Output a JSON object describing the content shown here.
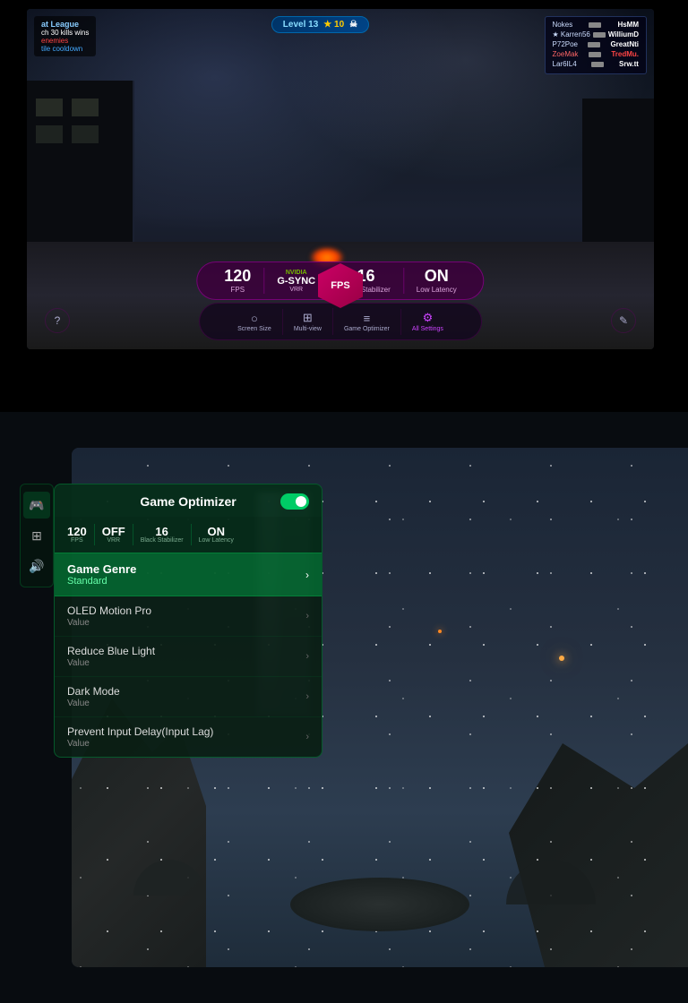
{
  "top": {
    "game_title": "at League",
    "kills_text": "ch 30 kills wins",
    "enemies_text": "enemies",
    "cooldown_text": "tile cooldown",
    "level_badge": "Level 13",
    "level_stars": "★ 10",
    "skull_icon": "☠",
    "players": [
      {
        "name": "Nokes",
        "weapon": "rifle",
        "score": "HsMM"
      },
      {
        "name": "Karren56",
        "weapon": "pistol",
        "score": "WilliumD"
      },
      {
        "name": "P72Poe",
        "weapon": "rifle",
        "score": "GreatNti"
      },
      {
        "name": "ZoeMak",
        "weapon": "rifle",
        "score": "TredMu."
      },
      {
        "name": "Lar6IL4",
        "weapon": "rifle",
        "score": "Srw.tt"
      }
    ],
    "fps_value": "120",
    "fps_label": "FPS",
    "gsync_nvidia": "NVIDIA",
    "gsync_label": "G-SYNC",
    "gsync_sub": "VRR",
    "fps_badge_label": "FPS",
    "black_stab_value": "16",
    "black_stab_label": "Black Stabilizer",
    "latency_value": "ON",
    "latency_label": "Low Latency",
    "toolbar_items": [
      {
        "id": "screen-size",
        "label": "Screen Size",
        "icon": "○"
      },
      {
        "id": "multi-view",
        "label": "Multi-view",
        "icon": "⊞"
      },
      {
        "id": "game-optimizer",
        "label": "Game Optimizer",
        "icon": "≡"
      },
      {
        "id": "all-settings",
        "label": "All Settings",
        "icon": "⚙"
      }
    ]
  },
  "bottom": {
    "panel": {
      "title": "Game Optimizer",
      "toggle_on": true,
      "mini_stats": [
        {
          "value": "120",
          "label": "FPS"
        },
        {
          "value": "OFF",
          "label": "VRR"
        },
        {
          "value": "16",
          "label": "Black Stabilizer"
        },
        {
          "value": "ON",
          "label": "Low Latency"
        }
      ],
      "menu_items": [
        {
          "id": "game-genre",
          "title": "Game Genre",
          "value": "Standard",
          "highlighted": true
        },
        {
          "id": "oled-motion-pro",
          "title": "OLED Motion Pro",
          "value": "Value",
          "highlighted": false
        },
        {
          "id": "reduce-blue-light",
          "title": "Reduce Blue Light",
          "value": "Value",
          "highlighted": false
        },
        {
          "id": "dark-mode",
          "title": "Dark Mode",
          "value": "Value",
          "highlighted": false
        },
        {
          "id": "prevent-input-delay",
          "title": "Prevent Input Delay(Input Lag)",
          "value": "Value",
          "highlighted": false
        }
      ],
      "side_icons": [
        {
          "id": "gamepad",
          "icon": "🎮",
          "active": true
        },
        {
          "id": "settings",
          "icon": "⊞",
          "active": false
        },
        {
          "id": "volume",
          "icon": "🔊",
          "active": false
        }
      ]
    }
  }
}
